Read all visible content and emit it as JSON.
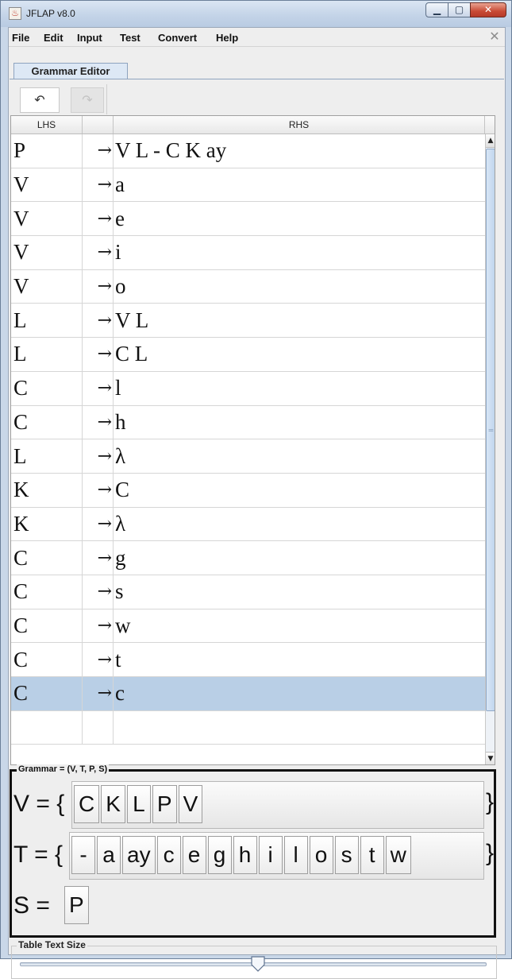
{
  "window": {
    "title": "JFLAP v8.0",
    "icon": "java-cup-icon"
  },
  "menu": {
    "items": [
      "File",
      "Edit",
      "Input",
      "Test",
      "Convert",
      "Help"
    ],
    "close_glyph": "✕"
  },
  "tabs": [
    {
      "label": "Grammar Editor",
      "selected": true
    }
  ],
  "toolbar": {
    "undo_glyph": "↶",
    "redo_glyph": "↷",
    "redo_enabled": false
  },
  "table": {
    "headers": {
      "lhs": "LHS",
      "arrow": "",
      "rhs": "RHS"
    },
    "arrow_glyph": "→",
    "rows": [
      {
        "lhs": "P",
        "rhs": "V L - C K ay"
      },
      {
        "lhs": "V",
        "rhs": "a"
      },
      {
        "lhs": "V",
        "rhs": "e"
      },
      {
        "lhs": "V",
        "rhs": "i"
      },
      {
        "lhs": "V",
        "rhs": "o"
      },
      {
        "lhs": "L",
        "rhs": "V L"
      },
      {
        "lhs": "L",
        "rhs": "C L"
      },
      {
        "lhs": "C",
        "rhs": "l"
      },
      {
        "lhs": "C",
        "rhs": "h"
      },
      {
        "lhs": "L",
        "rhs": "λ"
      },
      {
        "lhs": "K",
        "rhs": "C"
      },
      {
        "lhs": "K",
        "rhs": "λ"
      },
      {
        "lhs": "C",
        "rhs": "g"
      },
      {
        "lhs": "C",
        "rhs": "s"
      },
      {
        "lhs": "C",
        "rhs": "w"
      },
      {
        "lhs": "C",
        "rhs": "t"
      },
      {
        "lhs": "C",
        "rhs": "c",
        "selected": true
      }
    ]
  },
  "grammar": {
    "title": "Grammar = (V, T, P, S)",
    "variables": {
      "label": "V = {",
      "symbols": [
        "C",
        "K",
        "L",
        "P",
        "V"
      ],
      "close": "}"
    },
    "terminals": {
      "label": "T = {",
      "symbols": [
        "-",
        "a",
        "ay",
        "c",
        "e",
        "g",
        "h",
        "i",
        "l",
        "o",
        "s",
        "t",
        "w"
      ],
      "close": "}"
    },
    "start": {
      "label": "S =",
      "symbol": "P"
    }
  },
  "text_size": {
    "title": "Table Text Size",
    "slider_value": 0.51
  },
  "colors": {
    "selection": "#b9cfe6",
    "border": "#111111"
  }
}
